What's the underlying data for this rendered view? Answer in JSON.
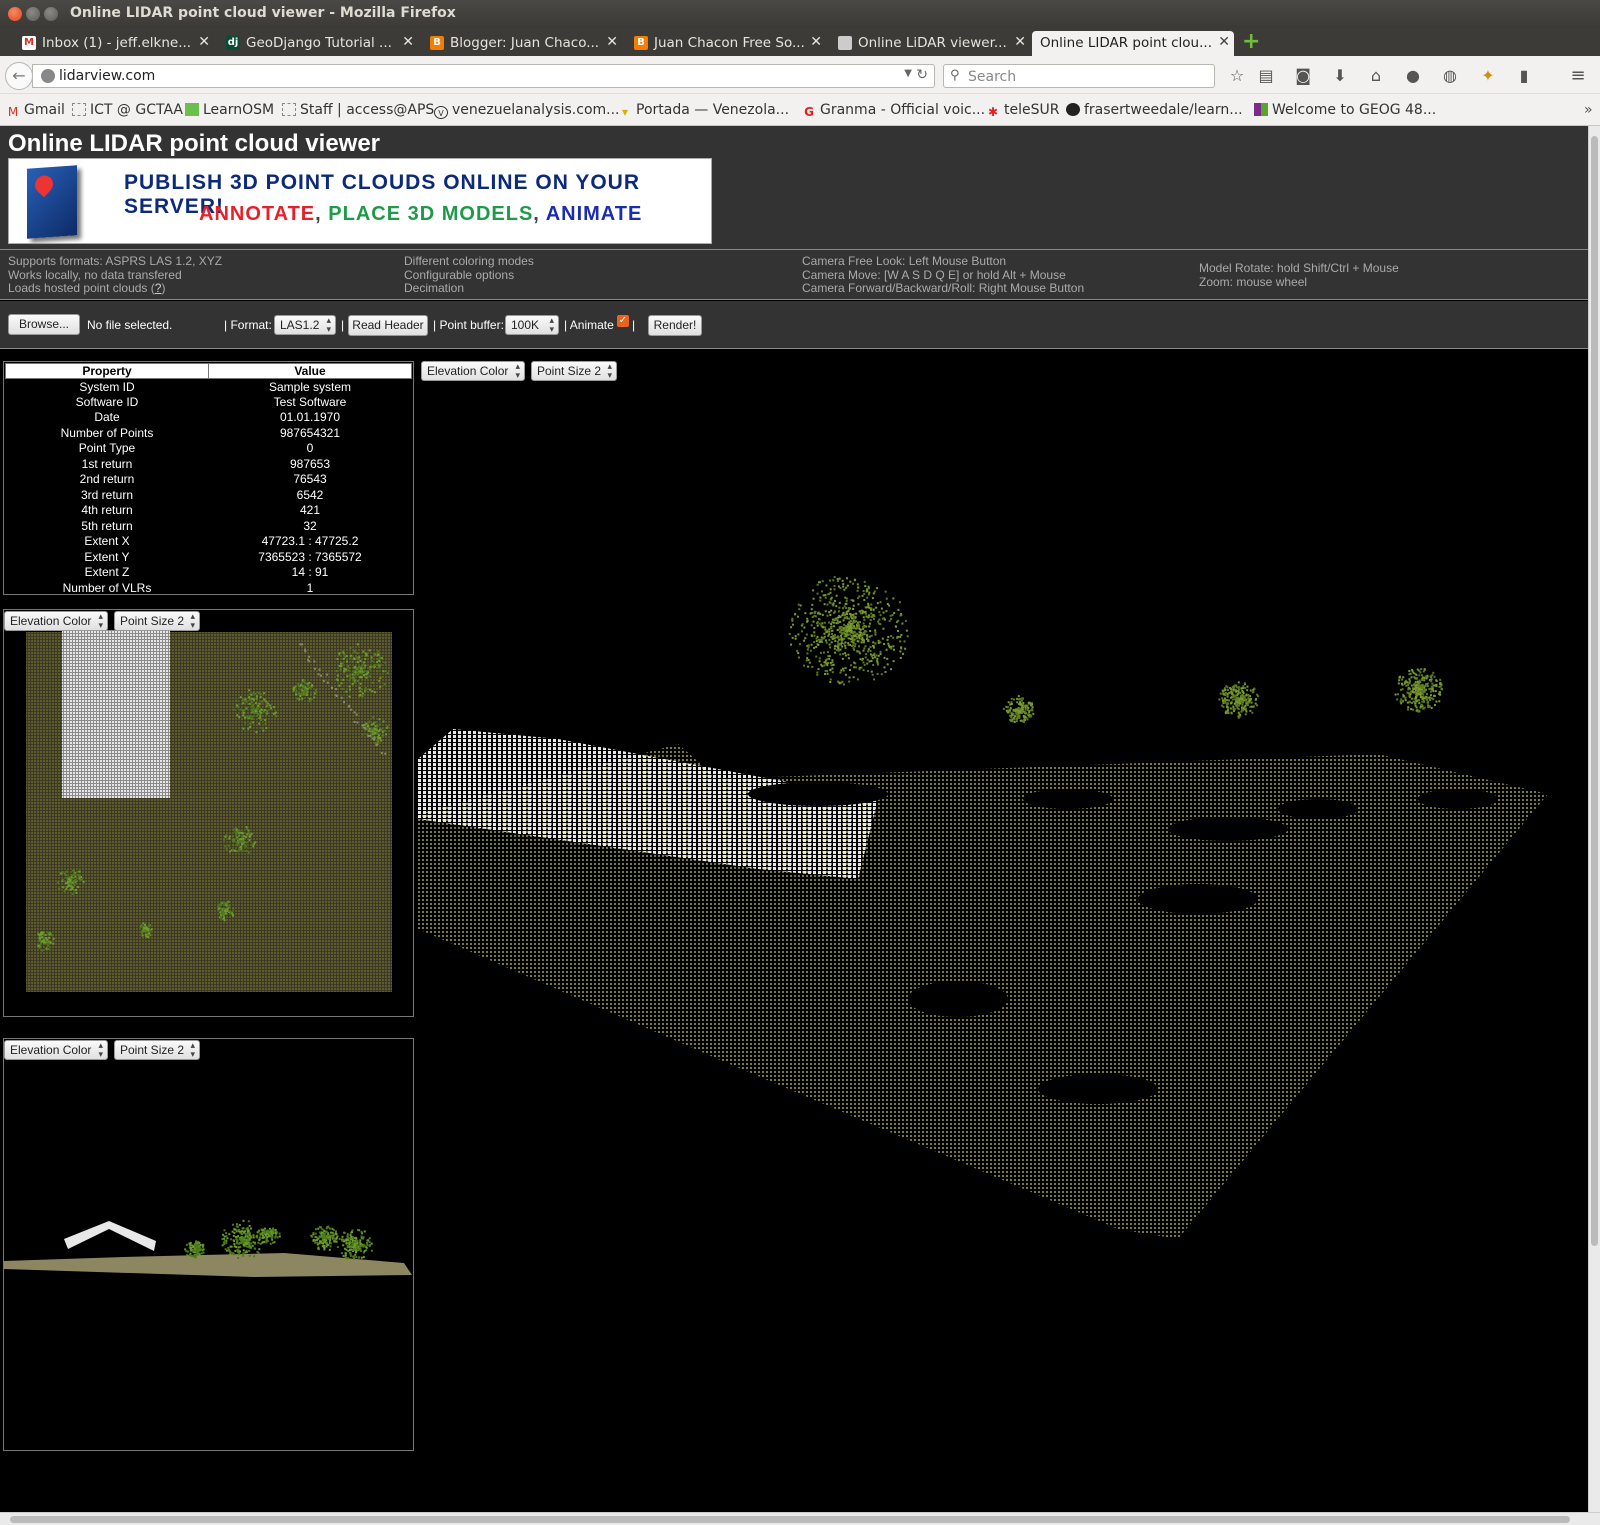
{
  "window": {
    "title": "Online LIDAR point cloud viewer - Mozilla Firefox"
  },
  "tabs": [
    {
      "label": "Inbox (1) - jeff.elkne...",
      "icon": "gmail-icon",
      "color": "#d93025"
    },
    {
      "label": "GeoDjango Tutorial ...",
      "icon": "django-icon",
      "color": "#0c4b33"
    },
    {
      "label": "Blogger: Juan Chaco...",
      "icon": "blogger-icon",
      "color": "#f57d00"
    },
    {
      "label": "Juan Chacon Free So...",
      "icon": "blogger-icon",
      "color": "#f57d00"
    },
    {
      "label": "Online LiDAR viewer...",
      "icon": "page-icon",
      "color": "#999999"
    },
    {
      "label": "Online LIDAR point clou...",
      "icon": "none",
      "color": "#f2f1f0",
      "active": true
    }
  ],
  "nav": {
    "url": "lidarview.com",
    "search_placeholder": "Search"
  },
  "bookmarks": [
    {
      "label": "Gmail",
      "icon": "gmail-icon"
    },
    {
      "label": "ICT @ GCTAA",
      "icon": "page-icon"
    },
    {
      "label": "LearnOSM",
      "icon": "osm-icon"
    },
    {
      "label": "Staff | access@APS",
      "icon": "page-icon"
    },
    {
      "label": "venezuelanalysis.com...",
      "icon": "va-icon"
    },
    {
      "label": "Portada — Venezola...",
      "icon": "flag-icon"
    },
    {
      "label": "Granma - Official voic...",
      "icon": "granma-icon"
    },
    {
      "label": "teleSUR",
      "icon": "telesur-icon"
    },
    {
      "label": "frasertweedale/learn...",
      "icon": "github-icon"
    },
    {
      "label": "Welcome to GEOG 48...",
      "icon": "geog-icon"
    }
  ],
  "page": {
    "title": "Online LIDAR point cloud viewer",
    "banner": {
      "line1": "PUBLISH 3D POINT CLOUDS ONLINE ON YOUR SERVER!",
      "line2_a": "ANNOTATE",
      "line2_b": "PLACE 3D MODELS",
      "line2_c": "ANIMATE",
      "sep": ","
    },
    "features": {
      "col1": [
        "Supports formats: ASPRS LAS 1.2, XYZ",
        "Works locally, no data transfered",
        "Loads hosted point clouds"
      ],
      "col1_help": "?",
      "col2": [
        "Different coloring modes",
        "Configurable options",
        "Decimation"
      ],
      "col3": [
        "Camera Free Look: Left Mouse Button",
        "Camera Move: [W A S D Q E] or hold Alt + Mouse",
        "Camera Forward/Backward/Roll: Right Mouse Button"
      ],
      "col4": [
        "Model Rotate: hold Shift/Ctrl + Mouse",
        "Zoom: mouse wheel"
      ]
    },
    "controls": {
      "browse_label": "Browse...",
      "file_status": "No file selected.",
      "format_label": "| Format:",
      "format_value": "LAS1.2",
      "read_header": "Read Header",
      "buffer_label": "| Point buffer:",
      "buffer_value": "100K",
      "animate_label": "| Animate",
      "animate_end": "|",
      "render": "Render!"
    },
    "viewport_controls": {
      "color_mode": "Elevation Color",
      "point_size": "Point Size 2"
    },
    "properties": {
      "headers": [
        "Property",
        "Value"
      ],
      "rows": [
        [
          "System ID",
          "Sample system"
        ],
        [
          "Software ID",
          "Test Software"
        ],
        [
          "Date",
          "01.01.1970"
        ],
        [
          "Number of Points",
          "987654321"
        ],
        [
          "Point Type",
          "0"
        ],
        [
          "1st return",
          "987653"
        ],
        [
          "2nd return",
          "76543"
        ],
        [
          "3rd return",
          "6542"
        ],
        [
          "4th return",
          "421"
        ],
        [
          "5th return",
          "32"
        ],
        [
          "Extent X",
          "47723.1 : 47725.2"
        ],
        [
          "Extent Y",
          "7365523 : 7365572"
        ],
        [
          "Extent Z",
          "14 : 91"
        ],
        [
          "Number of VLRs",
          "1"
        ]
      ]
    }
  },
  "colors": {
    "ground": "#7a7a3a",
    "vegetation": "#6e8a2e",
    "roof": "#e8e8e8",
    "accent_orange": "#e8631d"
  }
}
